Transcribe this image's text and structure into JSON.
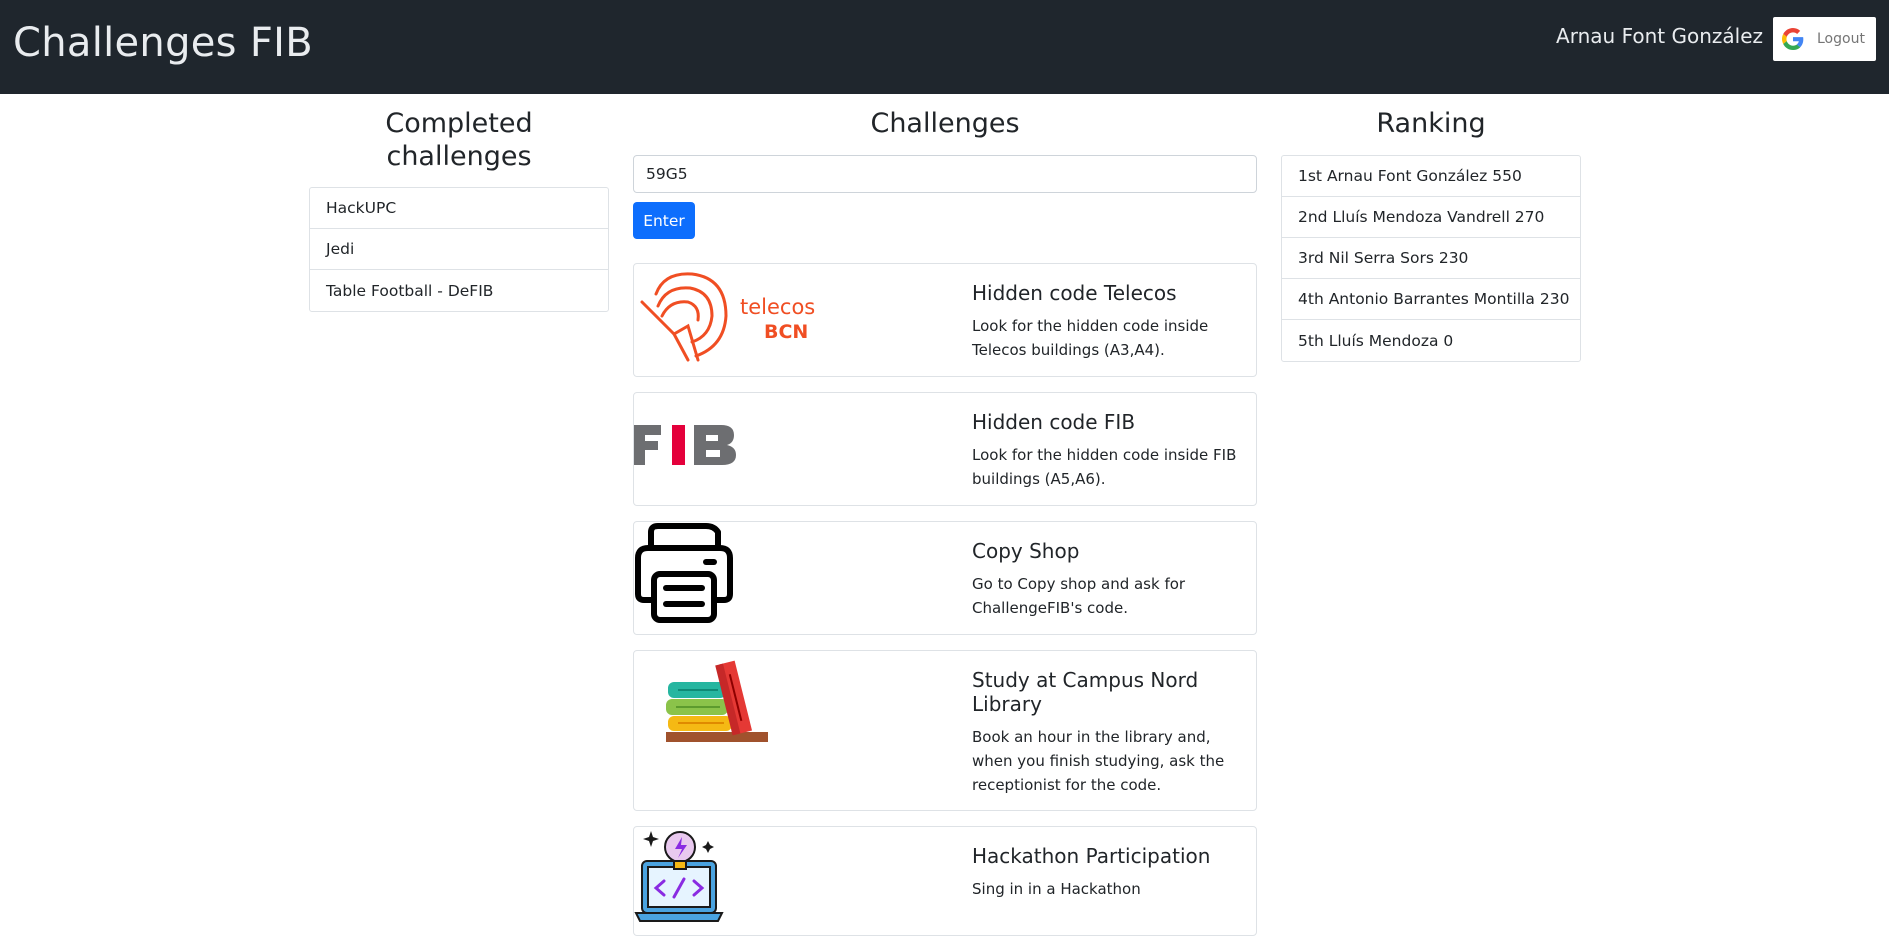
{
  "header": {
    "brand": "Challenges FIB",
    "user_name": "Arnau Font González",
    "logout_label": "Logout"
  },
  "completed": {
    "title": "Completed challenges",
    "items": [
      {
        "label": "HackUPC"
      },
      {
        "label": "Jedi"
      },
      {
        "label": "Table Football - DeFIB"
      }
    ]
  },
  "challenges": {
    "title": "Challenges",
    "code_input_value": "59G5",
    "enter_label": "Enter",
    "cards": [
      {
        "title": "Hidden code Telecos",
        "text": "Look for the hidden code inside Telecos buildings (A3,A4).",
        "icon": "telecos-bcn-logo",
        "logo_text": "telecos",
        "logo_subtext": "BCN"
      },
      {
        "title": "Hidden code FIB",
        "text": "Look for the hidden code inside FIB buildings (A5,A6).",
        "icon": "fib-logo",
        "logo_text": "FIB"
      },
      {
        "title": "Copy Shop",
        "text": "Go to Copy shop and ask for ChallengeFIB's code.",
        "icon": "printer-icon"
      },
      {
        "title": "Study at Campus Nord Library",
        "text": "Book an hour in the library and, when you finish studying, ask the receptionist for the code.",
        "icon": "books-icon"
      },
      {
        "title": "Hackathon Participation",
        "text": "Sing in in a Hackathon",
        "icon": "laptop-code-icon"
      }
    ]
  },
  "ranking": {
    "title": "Ranking",
    "items": [
      {
        "label": "1st Arnau Font González 550"
      },
      {
        "label": "2nd Lluís Mendoza Vandrell 270"
      },
      {
        "label": "3rd Nil Serra Sors 230"
      },
      {
        "label": "4th Antonio Barrantes Montilla 230"
      },
      {
        "label": "5th Lluís Mendoza 0"
      }
    ]
  },
  "colors": {
    "navbar": "#1f262d",
    "primary": "#0d6efd",
    "telecos_accent": "#f04e23",
    "fib_red": "#e4003b"
  }
}
